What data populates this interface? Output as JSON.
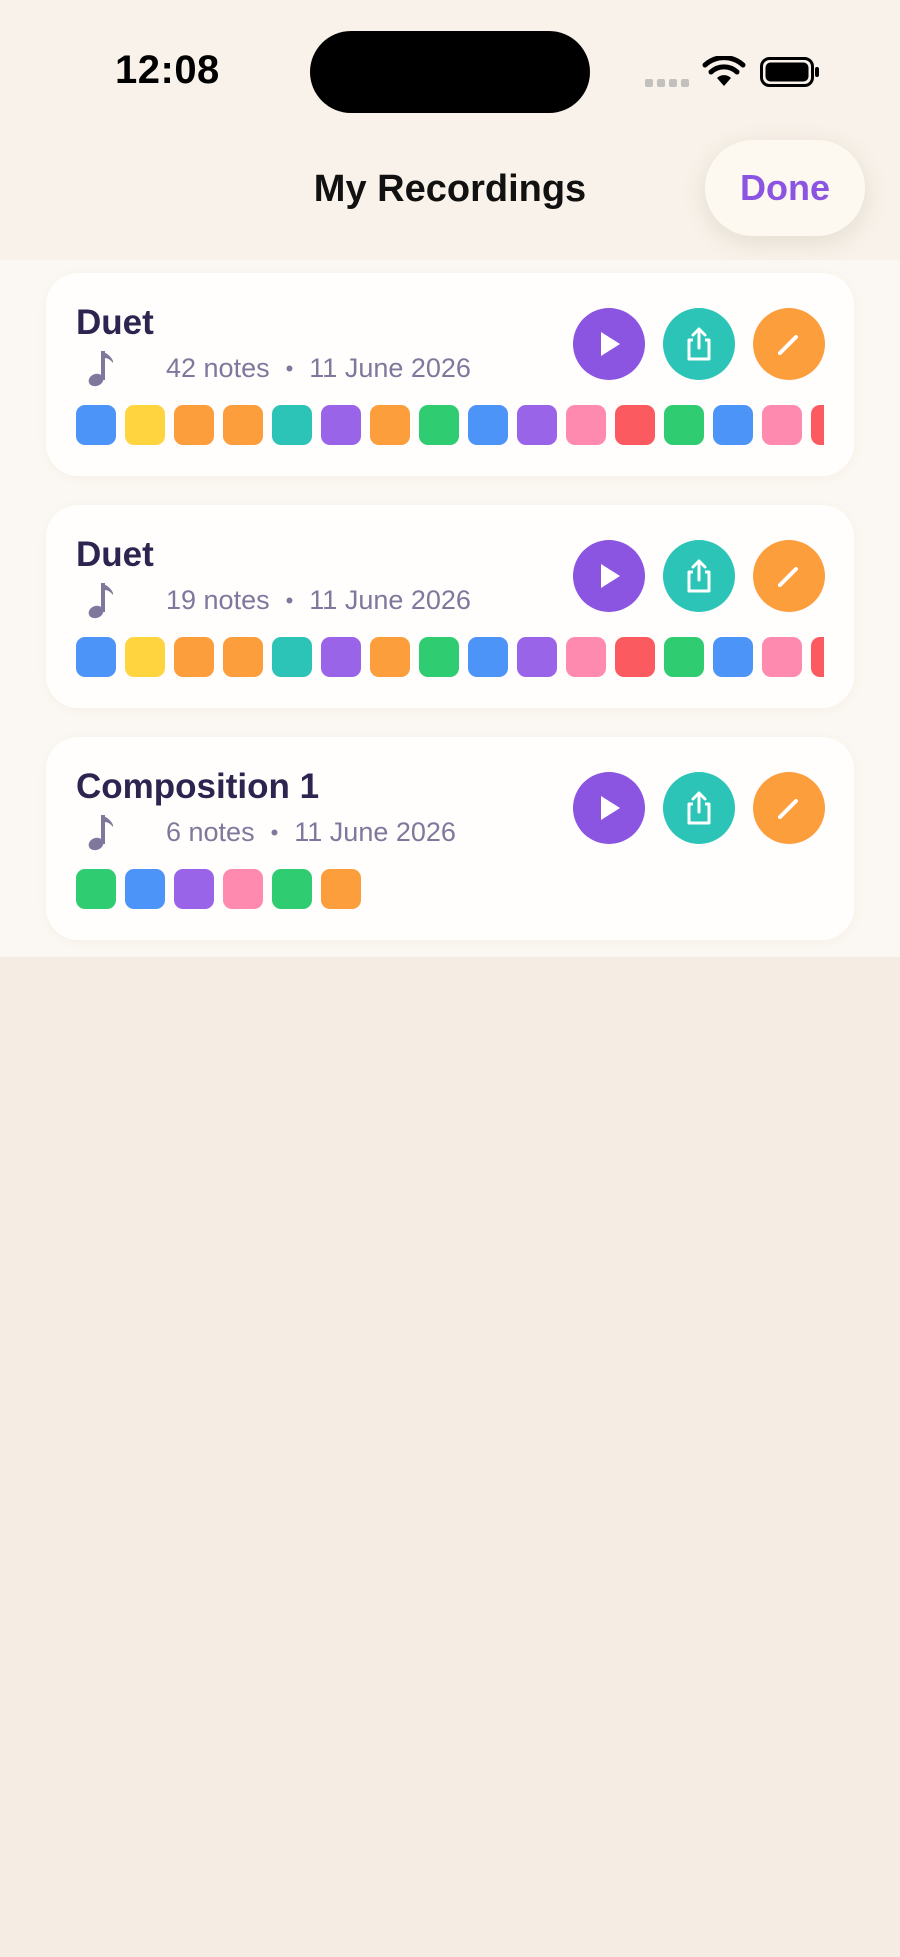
{
  "status": {
    "time": "12:08"
  },
  "header": {
    "title": "My Recordings",
    "done_label": "Done"
  },
  "colors": {
    "accent": "#8b55e2",
    "teal": "#2bc4b6",
    "orange": "#fc9e3c",
    "blue": "#4d94f8",
    "yellow": "#ffd43f",
    "purple": "#9a64e8",
    "green": "#30cc72",
    "pink": "#ff8ab0",
    "red": "#fb5b60"
  },
  "recordings": [
    {
      "title": "Duet",
      "notes": "42 notes",
      "date": "11 June 2026",
      "chips": [
        "blue",
        "yellow",
        "orange",
        "orange",
        "teal",
        "purple",
        "orange",
        "green",
        "blue",
        "purple",
        "pink",
        "red",
        "green",
        "blue",
        "pink",
        "red"
      ]
    },
    {
      "title": "Duet",
      "notes": "19 notes",
      "date": "11 June 2026",
      "chips": [
        "blue",
        "yellow",
        "orange",
        "orange",
        "teal",
        "purple",
        "orange",
        "green",
        "blue",
        "purple",
        "pink",
        "red",
        "green",
        "blue",
        "pink",
        "red"
      ]
    },
    {
      "title": "Composition 1",
      "notes": "6 notes",
      "date": "11 June 2026",
      "chips": [
        "green",
        "blue",
        "purple",
        "pink",
        "green",
        "orange"
      ]
    }
  ],
  "icons": {
    "note": "music-note-icon",
    "play": "play-icon",
    "share": "share-icon",
    "edit": "pencil-icon"
  }
}
